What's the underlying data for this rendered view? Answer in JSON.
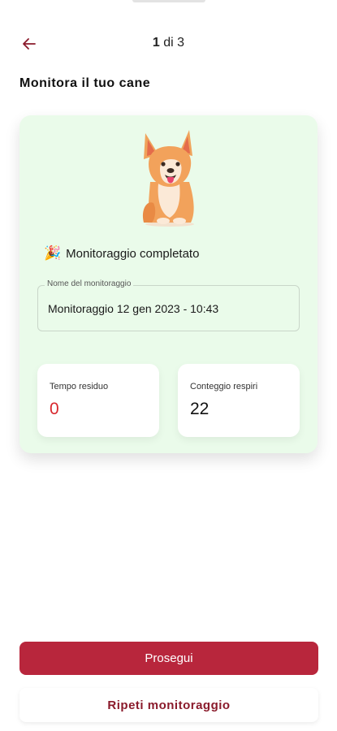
{
  "header": {
    "step_current": "1",
    "step_rest": " di 3"
  },
  "page": {
    "title": "Monitora il tuo cane"
  },
  "card": {
    "status_icon": "party-popper-icon",
    "status_emoji": "🎉",
    "status_text": "Monitoraggio completato",
    "field": {
      "label": "Nome del monitoraggio",
      "value": "Monitoraggio 12 gen 2023 - 10:43"
    },
    "stats": {
      "time_label": "Tempo residuo",
      "time_value": "0",
      "breaths_label": "Conteggio respiri",
      "breaths_value": "22"
    }
  },
  "actions": {
    "continue_label": "Prosegui",
    "repeat_label": "Ripeti monitoraggio"
  },
  "colors": {
    "accent": "#b8263c",
    "card_bg": "#eafbea",
    "value_red": "#d8282e"
  }
}
